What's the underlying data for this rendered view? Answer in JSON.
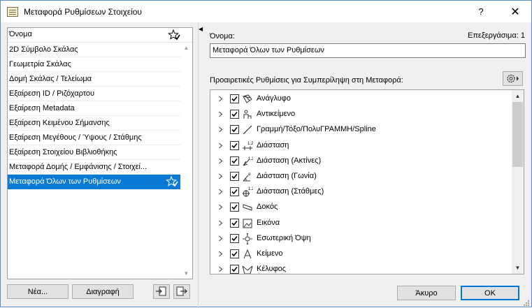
{
  "window": {
    "title": "Μεταφορά Ρυθμίσεων Στοιχείου",
    "help_glyph": "?",
    "close_glyph": "✕"
  },
  "left": {
    "header": "Όνομα",
    "items": [
      {
        "label": "2D Σύμβολο Σκάλας"
      },
      {
        "label": "Γεωμετρία Σκάλας"
      },
      {
        "label": "Δομή Σκάλας / Τελείωμα"
      },
      {
        "label": "Εξαίρεση ID / Ριζόχαρτου"
      },
      {
        "label": "Εξαίρεση Metadata"
      },
      {
        "label": "Εξαίρεση Κειμένου Σήμανσης"
      },
      {
        "label": "Εξαίρεση Μεγέθους / Ύψους / Στάθμης"
      },
      {
        "label": "Εξαίρεση Στοιχείου Βιβλιοθήκης"
      },
      {
        "label": "Μεταφορά Δομής / Εμφάνισης / Στοιχεί..."
      },
      {
        "label": "Μεταφορά Όλων των Ρυθμίσεων",
        "selected": true
      }
    ],
    "new_button": "Νέα...",
    "delete_button": "Διαγραφή"
  },
  "right": {
    "name_label": "Όνομα:",
    "editable_label": "Επεξεργάσιμα: 1",
    "name_value": "Μεταφορά Όλων των Ρυθμίσεων",
    "options_label": "Προαιρετικές Ρυθμίσεις για Συμπερίληψη στη Μεταφορά:",
    "options": [
      {
        "label": "Ανάγλυφο",
        "icon": "mesh-icon",
        "checked": true
      },
      {
        "label": "Αντικείμενο",
        "icon": "object-icon",
        "checked": true
      },
      {
        "label": "Γραμμή/Τόξο/ΠολυΓΡΑΜΜΗ/Spline",
        "icon": "line-icon",
        "checked": true
      },
      {
        "label": "Διάσταση",
        "icon": "dimension-icon",
        "checked": true
      },
      {
        "label": "Διάσταση (Ακτίνες)",
        "icon": "radial-dimension-icon",
        "checked": true
      },
      {
        "label": "Διάσταση (Γωνία)",
        "icon": "angle-dimension-icon",
        "checked": true
      },
      {
        "label": "Διάσταση (Στάθμες)",
        "icon": "level-dimension-icon",
        "checked": true
      },
      {
        "label": "Δοκός",
        "icon": "beam-icon",
        "checked": true
      },
      {
        "label": "Εικόνα",
        "icon": "picture-icon",
        "checked": true
      },
      {
        "label": "Εσωτερική Όψη",
        "icon": "interior-elevation-icon",
        "checked": true
      },
      {
        "label": "Κείμενο",
        "icon": "text-icon",
        "checked": true
      },
      {
        "label": "Κέλυφος",
        "icon": "shell-icon",
        "checked": true
      }
    ],
    "cancel_button": "Άκυρο",
    "ok_button": "OK"
  },
  "colors": {
    "selection": "#0a7ad4",
    "accent_border": "#0078d7"
  }
}
